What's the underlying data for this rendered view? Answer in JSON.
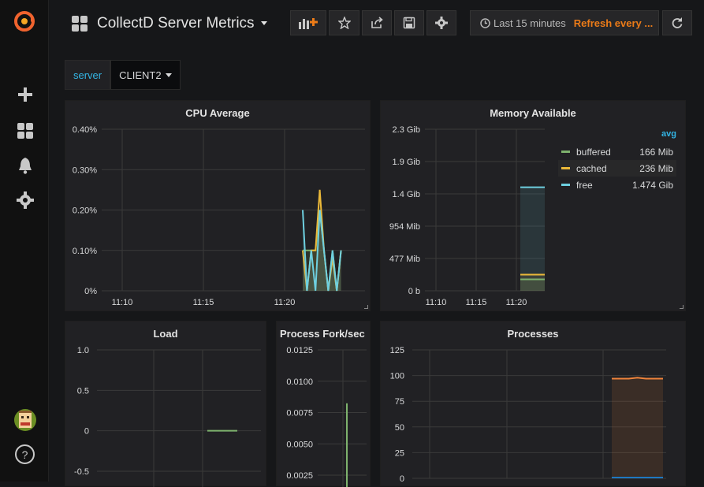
{
  "dashboard": {
    "title": "CollectD Server Metrics"
  },
  "timepicker": {
    "range": "Last 15 minutes",
    "refresh": "Refresh every ..."
  },
  "variables": [
    {
      "label": "server",
      "value": "CLIENT2"
    }
  ],
  "colors": {
    "green": "#7eb26d",
    "yellow": "#eab839",
    "blue": "#6ed0e0",
    "orange": "#ef843c",
    "accent": "#33b5e5"
  },
  "icons": [
    "grafana-logo-icon",
    "plus-icon",
    "dashboards-icon",
    "bell-icon",
    "gear-icon",
    "help-icon",
    "add-panel-icon",
    "star-icon",
    "share-icon",
    "save-icon",
    "settings-icon",
    "clock-icon",
    "refresh-icon"
  ],
  "panels": {
    "cpu": {
      "title": "CPU Average"
    },
    "memory": {
      "title": "Memory Available",
      "legend_header": "avg",
      "legend": [
        {
          "name": "buffered",
          "value": "166 Mib"
        },
        {
          "name": "cached",
          "value": "236 Mib"
        },
        {
          "name": "free",
          "value": "1.474 Gib"
        }
      ]
    },
    "load": {
      "title": "Load"
    },
    "fork": {
      "title": "Process Fork/sec"
    },
    "processes": {
      "title": "Processes"
    }
  },
  "chart_data": [
    {
      "type": "line",
      "title": "CPU Average",
      "x_ticks": [
        "11:10",
        "11:15",
        "11:20"
      ],
      "y_ticks": [
        "0%",
        "0.10%",
        "0.20%",
        "0.30%",
        "0.40%"
      ],
      "ylim": [
        0,
        0.4
      ],
      "series": [
        {
          "values": [
            0.2,
            0.0,
            0.1,
            0.0,
            0.2,
            0.1,
            0.0,
            0.1,
            0.0,
            0.1
          ]
        },
        {
          "values": [
            0.1,
            0.0,
            0.1,
            0.1,
            0.25,
            0.1,
            0.0,
            0.08,
            0.0,
            0.1
          ]
        },
        {
          "values": [
            0.1,
            0.1,
            0.1,
            0.1,
            0.2,
            0.1,
            0.0,
            0.1,
            0.0,
            0.1
          ]
        }
      ]
    },
    {
      "type": "area",
      "title": "Memory Available",
      "x_ticks": [
        "11:10",
        "11:15",
        "11:20"
      ],
      "y_ticks": [
        "0 b",
        "477 Mib",
        "954 Mib",
        "1.4 Gib",
        "1.9 Gib",
        "2.3 Gib"
      ],
      "series": [
        {
          "name": "buffered",
          "value": "166 Mib"
        },
        {
          "name": "cached",
          "value": "236 Mib"
        },
        {
          "name": "free",
          "value": "1.474 Gib"
        }
      ]
    },
    {
      "type": "line",
      "title": "Load",
      "y_ticks": [
        "-0.5",
        "0",
        "0.5",
        "1.0"
      ],
      "ylim": [
        -0.5,
        1.0
      ],
      "series": [
        {
          "values": [
            0,
            0
          ]
        }
      ]
    },
    {
      "type": "bar",
      "title": "Process Fork/sec",
      "y_ticks": [
        "0.0025",
        "0.0050",
        "0.0075",
        "0.0100",
        "0.0125"
      ],
      "series": [
        {
          "values": [
            0.01
          ]
        }
      ]
    },
    {
      "type": "area",
      "title": "Processes",
      "y_ticks": [
        "0",
        "25",
        "50",
        "75",
        "100",
        "125"
      ],
      "ylim": [
        0,
        125
      ],
      "series": [
        {
          "values": [
            97,
            97,
            97,
            98,
            97,
            97,
            97
          ]
        },
        {
          "values": [
            0,
            0,
            0,
            0,
            0,
            0,
            0
          ]
        }
      ]
    }
  ]
}
